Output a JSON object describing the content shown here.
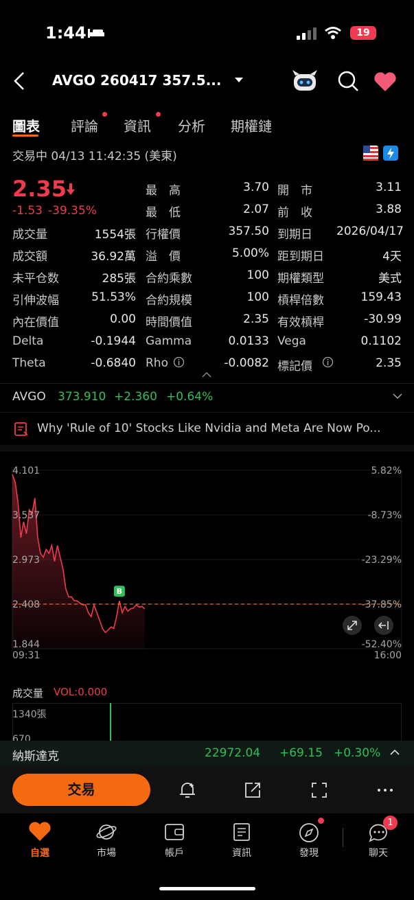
{
  "status_bar": {
    "time": "1:44",
    "battery": "19"
  },
  "header": {
    "title": "AVGO 260417 357.5..."
  },
  "tabs": [
    {
      "label": "圖表",
      "active": true
    },
    {
      "label": "評論",
      "dot": true
    },
    {
      "label": "資訊",
      "dot": true
    },
    {
      "label": "分析"
    },
    {
      "label": "期權鏈"
    }
  ],
  "trading_status": "交易中 04/13 11:42:35 (美東)",
  "quote": {
    "price": "2.35",
    "change": "-1.53",
    "change_pct": "-39.35%",
    "fields": [
      [
        "最　高",
        "3.70",
        "開　市",
        "3.11"
      ],
      [
        "最　低",
        "2.07",
        "前　收",
        "3.88"
      ],
      [
        "成交量",
        "1554張",
        "行權價",
        "357.50",
        "到期日",
        "2026/04/17"
      ],
      [
        "成交額",
        "36.92萬",
        "溢　價",
        "5.00%",
        "距到期日",
        "4天"
      ],
      [
        "未平仓数",
        "285張",
        "合約乘數",
        "100",
        "期權類型",
        "美式"
      ],
      [
        "引伸波幅",
        "51.53%",
        "合約規模",
        "100",
        "槓桿倍數",
        "159.43"
      ],
      [
        "內在價值",
        "0.00",
        "時間價值",
        "2.35",
        "有效槓桿",
        "-30.99"
      ],
      [
        "Delta",
        "-0.1944",
        "Gamma",
        "0.0133",
        "Vega",
        "0.1102"
      ],
      [
        "Theta",
        "-0.6840",
        "Rho",
        "-0.0082",
        "標記價",
        "2.35"
      ]
    ]
  },
  "underlying": {
    "symbol": "AVGO",
    "price": "373.910",
    "change": "+2.360",
    "change_pct": "+0.64%"
  },
  "news_headline": "Why 'Rule of 10' Stocks Like Nvidia and Meta Are Now Po...",
  "chart_data": {
    "type": "line",
    "y_left_ticks": [
      "4.101",
      "3.537",
      "2.973",
      "2.408",
      "1.844"
    ],
    "y_right_ticks": [
      "5.82%",
      "-8.73%",
      "-23.29%",
      "-37.85%",
      "-52.40%"
    ],
    "x_ticks": [
      "09:31",
      "16:00"
    ],
    "ylim": [
      1.844,
      4.101
    ],
    "reference_line": 2.408,
    "marker_label": "B",
    "series": [
      {
        "values": [
          4.05,
          3.95,
          3.7,
          3.25,
          3.45,
          3.3,
          3.6,
          3.55,
          3.75,
          3.25,
          3.05,
          3.0,
          3.1,
          3.05,
          3.15,
          2.95,
          3.15,
          3.0,
          2.85,
          2.6,
          2.5,
          2.5,
          2.45,
          2.45,
          2.42,
          2.4,
          2.4,
          2.3,
          2.25,
          2.4,
          2.3,
          2.2,
          2.1,
          2.05,
          2.08,
          2.12,
          2.1,
          2.25,
          2.45,
          2.3,
          2.38,
          2.32,
          2.35,
          2.36,
          2.4,
          2.37,
          2.38,
          2.35
        ]
      }
    ]
  },
  "volume": {
    "title": "成交量",
    "vol_label": "VOL:0.000",
    "ticks": [
      "1340張",
      "670"
    ]
  },
  "index_bar": {
    "name": "納斯達克",
    "value": "22972.04",
    "change": "+69.15",
    "change_pct": "+0.30%"
  },
  "action_bar": {
    "trade_label": "交易"
  },
  "bottom_nav": [
    {
      "label": "自選",
      "active": true
    },
    {
      "label": "市場"
    },
    {
      "label": "帳戶"
    },
    {
      "label": "資訊"
    },
    {
      "label": "發現",
      "dot": true
    },
    {
      "label": "聊天",
      "badge": "1"
    }
  ],
  "colors": {
    "up": "#2fbf5b",
    "down": "#ef3b4f",
    "accent": "#f36a10",
    "background": "#000000"
  }
}
